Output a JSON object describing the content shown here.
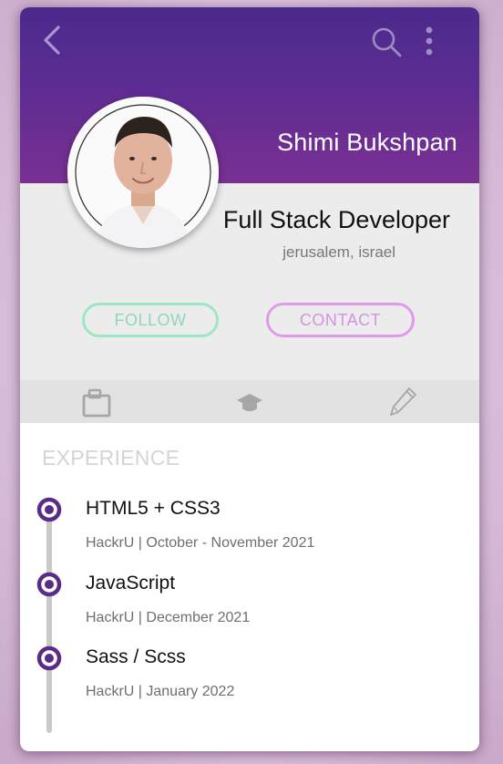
{
  "header": {
    "back_icon": "chevron-left-icon",
    "search_icon": "search-icon",
    "more_icon": "more-vertical-icon",
    "gradient_top": "#4b2a8b",
    "gradient_bottom": "#7a3093"
  },
  "profile": {
    "name": "Shimi Bukshpan",
    "title": "Full Stack Developer",
    "location": "jerusalem, israel",
    "avatar": "profile-photo"
  },
  "actions": {
    "follow_label": "FOLLOW",
    "contact_label": "CONTACT",
    "follow_color": "#9ce6c4",
    "contact_color": "#df9be9"
  },
  "tabs": [
    {
      "icon": "briefcase-icon",
      "active": true
    },
    {
      "icon": "graduation-cap-icon",
      "active": false
    },
    {
      "icon": "pencil-icon",
      "active": false
    }
  ],
  "experience": {
    "heading": "EXPERIENCE",
    "accent_color": "#5b2c86",
    "items": [
      {
        "title": "HTML5 + CSS3",
        "meta": "HackrU | October - November 2021"
      },
      {
        "title": "JavaScript",
        "meta": "HackrU | December 2021"
      },
      {
        "title": "Sass / Scss",
        "meta": "HackrU | January 2022"
      }
    ]
  }
}
